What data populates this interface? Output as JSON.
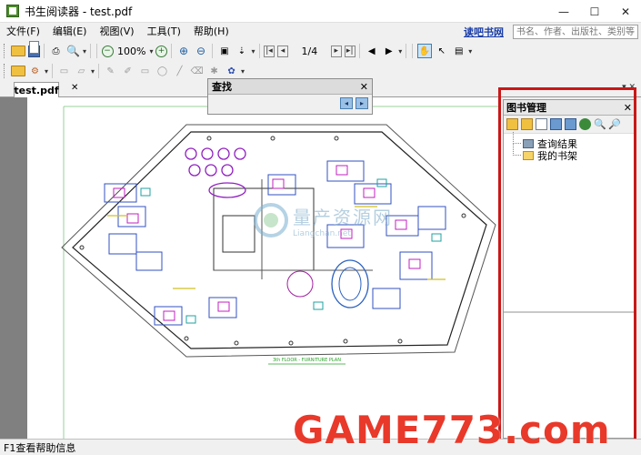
{
  "window": {
    "title": "书生阅读器 - test.pdf",
    "min": "—",
    "max": "☐",
    "close": "✕"
  },
  "menu": {
    "items": [
      "文件(F)",
      "编辑(E)",
      "视图(V)",
      "工具(T)",
      "帮助(H)"
    ],
    "reader_link": "读吧书网",
    "search_placeholder": "书名、作者、出版社、类别等"
  },
  "toolbar": {
    "zoom": "100%",
    "page": "1/4"
  },
  "tabs": {
    "active": "test.pdf",
    "close": "✕",
    "right_controls": "▾ ✕"
  },
  "find_dialog": {
    "title": "查找",
    "close": "✕"
  },
  "book_panel": {
    "title": "图书管理",
    "close": "✕",
    "tree": [
      "查询结果",
      "我的书架"
    ]
  },
  "drawing": {
    "caption": "3th FLOOR - FURNITURE PLAN"
  },
  "status": "F1查看帮助信息",
  "watermark": {
    "game": "GAME773.com",
    "cn": "量产资源网",
    "en": "Liangchan.net"
  }
}
